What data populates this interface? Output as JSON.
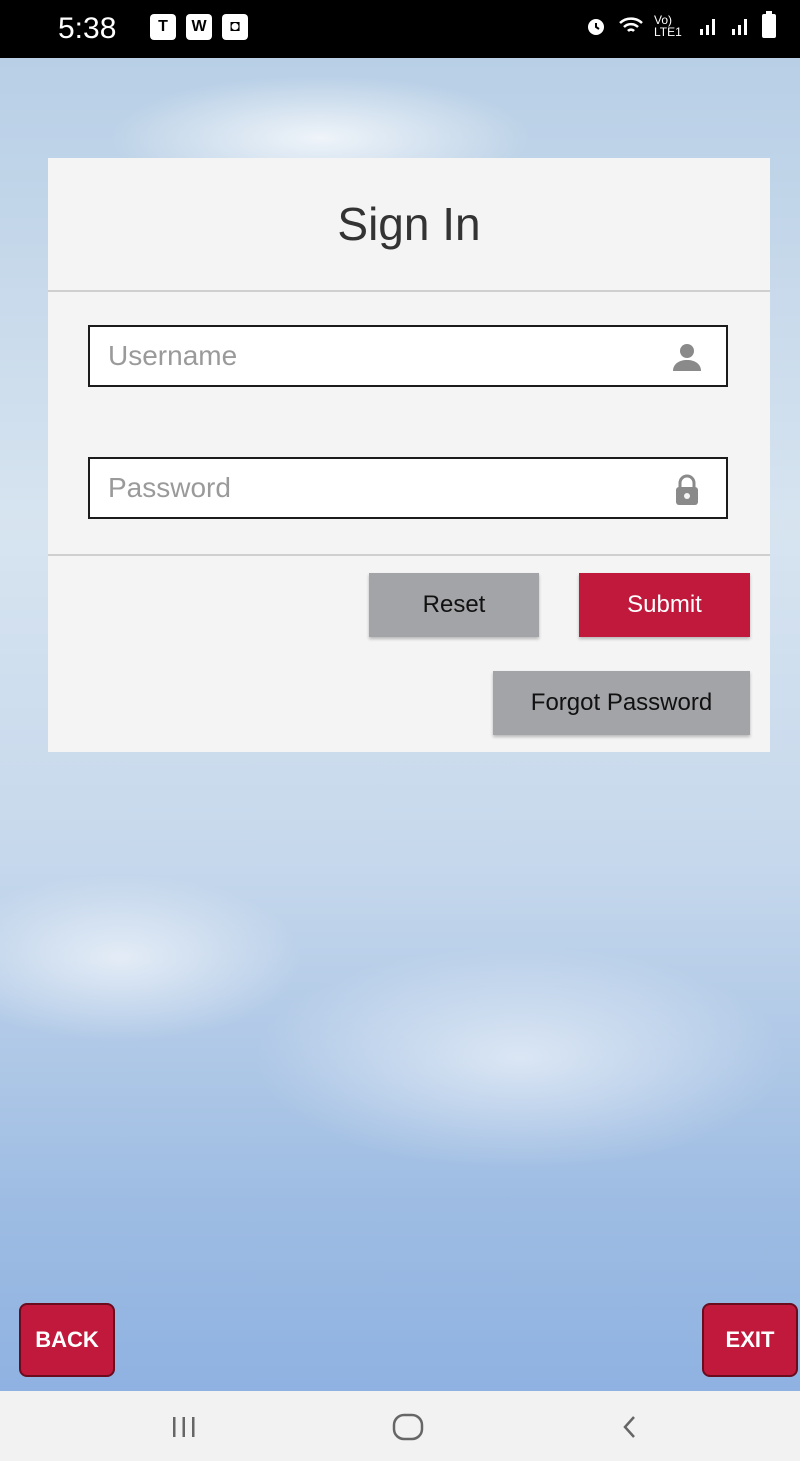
{
  "status_bar": {
    "time": "5:38",
    "left_icons": [
      "teams-icon",
      "w-icon",
      "clock-app-icon"
    ],
    "left_icon_glyphs": [
      "T",
      "W",
      "◘"
    ],
    "right_text": "Vo) LTE1"
  },
  "card": {
    "title": "Sign In",
    "username": {
      "placeholder": "Username",
      "value": ""
    },
    "password": {
      "placeholder": "Password",
      "value": ""
    },
    "reset_label": "Reset",
    "submit_label": "Submit",
    "forgot_label": "Forgot Password"
  },
  "footer": {
    "back_label": "BACK",
    "exit_label": "EXIT"
  },
  "colors": {
    "accent": "#c0193b",
    "secondary_button": "#a3a4a8",
    "card_background": "#f4f4f4"
  }
}
